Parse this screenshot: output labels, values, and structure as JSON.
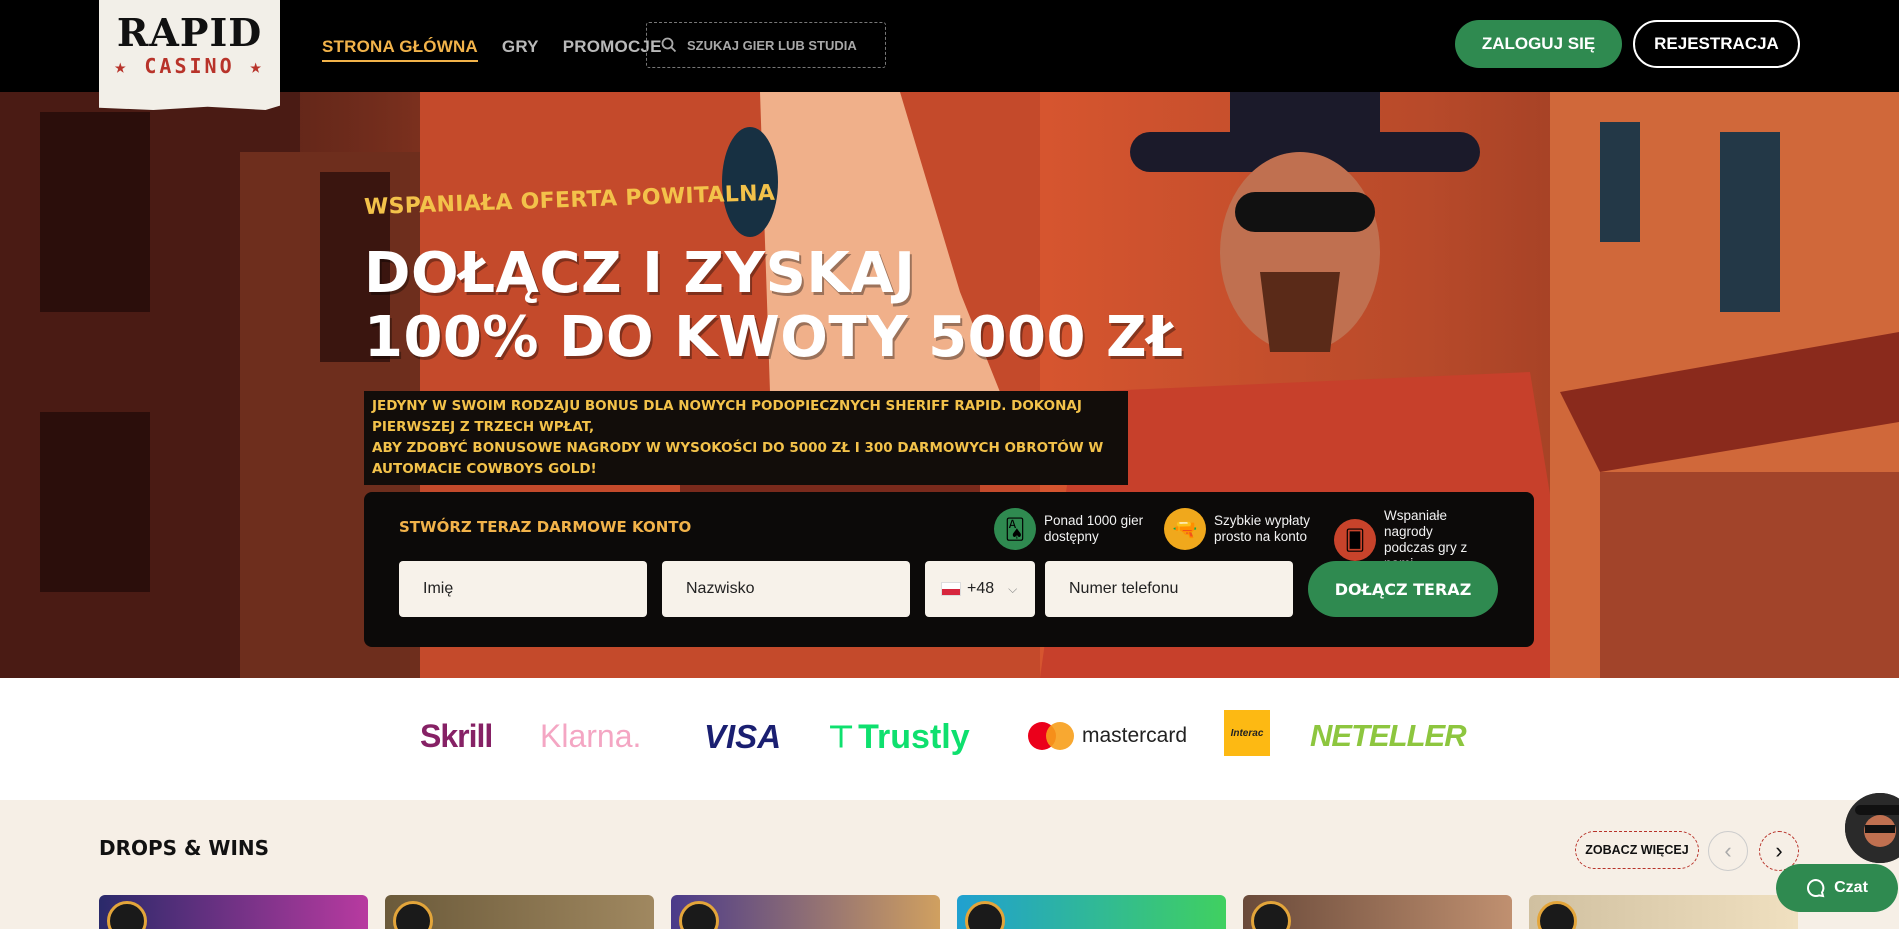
{
  "header": {
    "logo": {
      "line1": "RAPID",
      "line2": "★ CASINO ★"
    },
    "nav": [
      "STRONA GŁÓWNA",
      "GRY",
      "PROMOCJE"
    ],
    "search": {
      "placeholder": "SZUKAJ GIER LUB STUDIA"
    },
    "login_label": "ZALOGUJ SIĘ",
    "register_label": "REJESTRACJA"
  },
  "hero": {
    "subtitle": "WSPANIAŁA OFERTA POWITALNA",
    "title_line1": "DOŁĄCZ I ZYSKAJ",
    "title_line2": "100% DO KWOTY 5000 ZŁ",
    "desc_line1": "JEDYNY W SWOIM RODZAJU BONUS DLA NOWYCH PODOPIECZNYCH SHERIFF RAPID. DOKONAJ PIERWSZEJ Z TRZECH WPŁAT,",
    "desc_line2": "ABY ZDOBYĆ BONUSOWE NAGRODY W WYSOKOŚCI DO 5000 ZŁ I 300 DARMOWYCH OBROTÓW W AUTOMACIE COWBOYS GOLD!"
  },
  "signup": {
    "title": "STWÓRZ TERAZ DARMOWE KONTO",
    "features": [
      {
        "icon": "cards-icon",
        "color": "#2f8a50",
        "line1": "Ponad 1000 gier",
        "line2": "dostępny"
      },
      {
        "icon": "revolver-icon",
        "color": "#f0a81c",
        "line1": "Szybkie wypłaty",
        "line2": "prosto na konto"
      },
      {
        "icon": "reward-icon",
        "color": "#c8432b",
        "line1": "Wspaniałe nagrody",
        "line2": "podczas gry z nami"
      }
    ],
    "first_name_placeholder": "Imię",
    "last_name_placeholder": "Nazwisko",
    "phone_code": "+48",
    "phone_placeholder": "Numer telefonu",
    "join_label": "DOŁĄCZ TERAZ"
  },
  "payments": [
    {
      "name": "Skrill",
      "color": "#862165"
    },
    {
      "name": "Klarna.",
      "color": "#f4a6c3"
    },
    {
      "name": "VISA",
      "color": "#1a1f71"
    },
    {
      "name": "Trustly",
      "color": "#0ee06e"
    },
    {
      "name": "mastercard",
      "color": "#222222"
    },
    {
      "name": "Interac",
      "color": "#fdb913"
    },
    {
      "name": "NETELLER",
      "color": "#8dc63f"
    }
  ],
  "drops": {
    "title": "DROPS & WINS",
    "see_more": "ZOBACZ WIĘCEJ",
    "prev": "‹",
    "next": "›"
  },
  "chat_label": "Czat",
  "colors": {
    "accent_green": "#2f8a50",
    "accent_gold": "#f2b34a"
  }
}
